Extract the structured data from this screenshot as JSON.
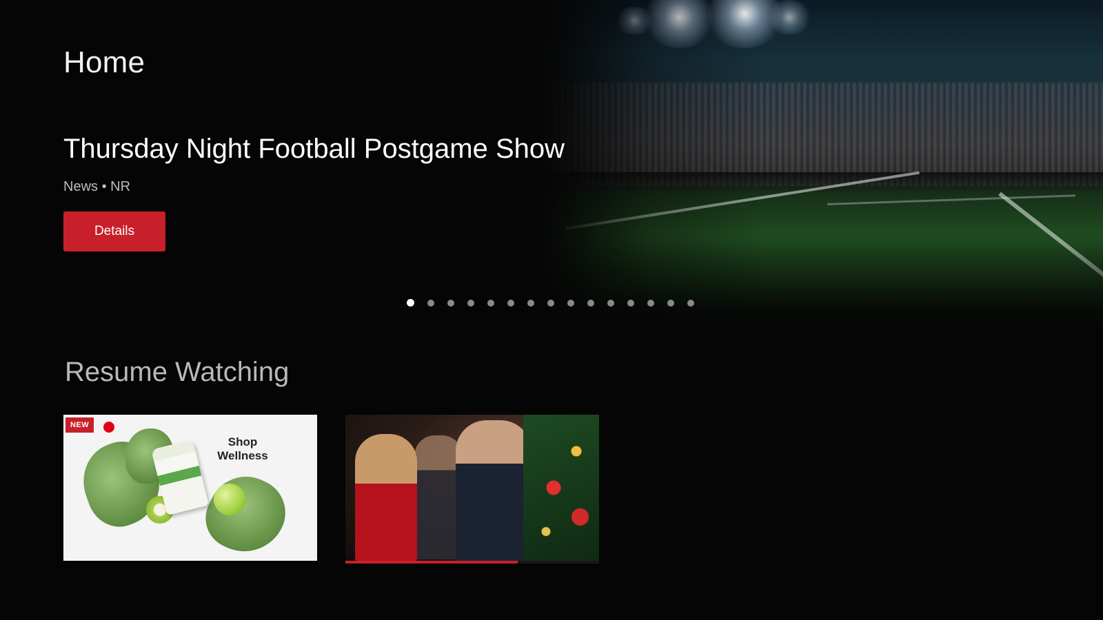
{
  "header": {
    "page_title": "Home"
  },
  "hero": {
    "title": "Thursday Night Football Postgame Show",
    "meta": "News • NR",
    "details_label": "Details",
    "carousel": {
      "total_pages": 15,
      "active_index": 0
    }
  },
  "resume_watching": {
    "title": "Resume Watching",
    "items": [
      {
        "badge": "NEW",
        "image_text": "Shop Wellness",
        "progress": 0.0
      },
      {
        "progress": 0.68
      }
    ]
  },
  "colors": {
    "accent": "#c8202a",
    "background": "#050505",
    "title_text": "#f2f2f2",
    "muted_text": "#b9b9b9"
  }
}
